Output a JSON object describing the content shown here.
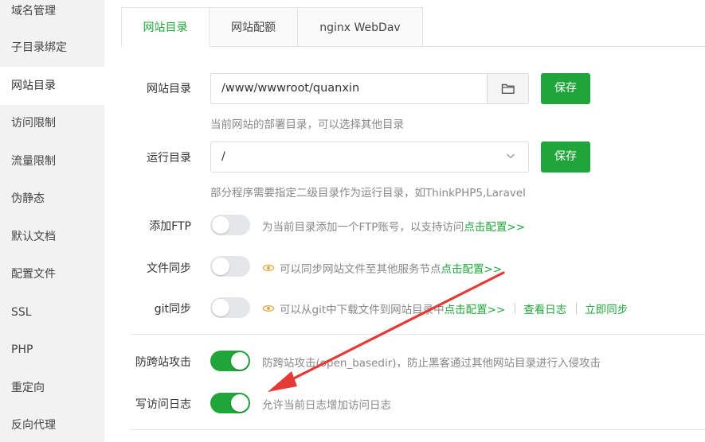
{
  "sidebar": {
    "items": [
      {
        "label": "域名管理"
      },
      {
        "label": "子目录绑定"
      },
      {
        "label": "网站目录"
      },
      {
        "label": "访问限制"
      },
      {
        "label": "流量限制"
      },
      {
        "label": "伪静态"
      },
      {
        "label": "默认文档"
      },
      {
        "label": "配置文件"
      },
      {
        "label": "SSL"
      },
      {
        "label": "PHP"
      },
      {
        "label": "重定向"
      },
      {
        "label": "反向代理"
      }
    ],
    "active": "网站目录"
  },
  "tabs": [
    {
      "label": "网站目录"
    },
    {
      "label": "网站配额"
    },
    {
      "label": "nginx WebDav"
    }
  ],
  "site_dir": {
    "label": "网站目录",
    "value": "/www/wwwroot/quanxin",
    "save": "保存",
    "hint": "当前网站的部署目录，可以选择其他目录"
  },
  "run_dir": {
    "label": "运行目录",
    "value": "/",
    "save": "保存",
    "hint": "部分程序需要指定二级目录作为运行目录，如ThinkPHP5,Laravel"
  },
  "ftp": {
    "label": "添加FTP",
    "desc": "为当前目录添加一个FTP账号，以支持访问",
    "link": "点击配置>>",
    "enabled": false
  },
  "file_sync": {
    "label": "文件同步",
    "desc": "可以同步网站文件至其他服务节点",
    "link": "点击配置>>",
    "enabled": false
  },
  "git_sync": {
    "label": "git同步",
    "desc": "可以从git中下载文件到网站目录中",
    "link": "点击配置>>",
    "view_log": "查看日志",
    "sync_now": "立即同步",
    "enabled": false
  },
  "anti_cross": {
    "label": "防跨站攻击",
    "desc": "防跨站攻击(open_basedir)，防止黑客通过其他网站目录进行入侵攻击",
    "enabled": true
  },
  "access_log": {
    "label": "写访问日志",
    "desc": "允许当前日志增加访问日志",
    "enabled": true
  },
  "colors": {
    "accent": "#20a53a",
    "annotation_arrow": "#e53935"
  }
}
